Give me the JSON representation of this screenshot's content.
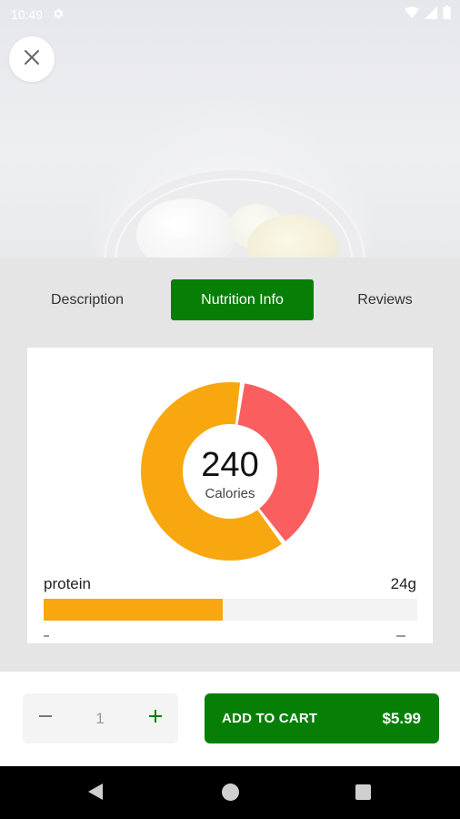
{
  "status_bar": {
    "time": "10:49",
    "icons": [
      "settings-icon",
      "wifi-icon",
      "signal-icon",
      "battery-icon"
    ]
  },
  "hero": {
    "image": "bowl-of-boiled-eggs"
  },
  "tabs": [
    {
      "label": "Description",
      "active": false
    },
    {
      "label": "Nutrition Info",
      "active": true
    },
    {
      "label": "Reviews",
      "active": false
    }
  ],
  "nutrition": {
    "calories_value": "240",
    "calories_label": "Calories",
    "nutrients": [
      {
        "name": "protein",
        "value": "24g",
        "fill_fraction": 0.48
      }
    ]
  },
  "chart_data": {
    "type": "donut",
    "center_value": "240",
    "center_label": "Calories",
    "segments": [
      {
        "portion": 0.375,
        "color": "#fb5e5e"
      },
      {
        "portion": 0.625,
        "color": "#f9a70f"
      }
    ]
  },
  "cart": {
    "quantity": "1",
    "add_to_cart_label": "ADD TO CART",
    "price": "$5.99"
  },
  "colors": {
    "brand_green": "#077f07",
    "bar_orange": "#f9a70f",
    "donut_red": "#fb5e5e"
  }
}
